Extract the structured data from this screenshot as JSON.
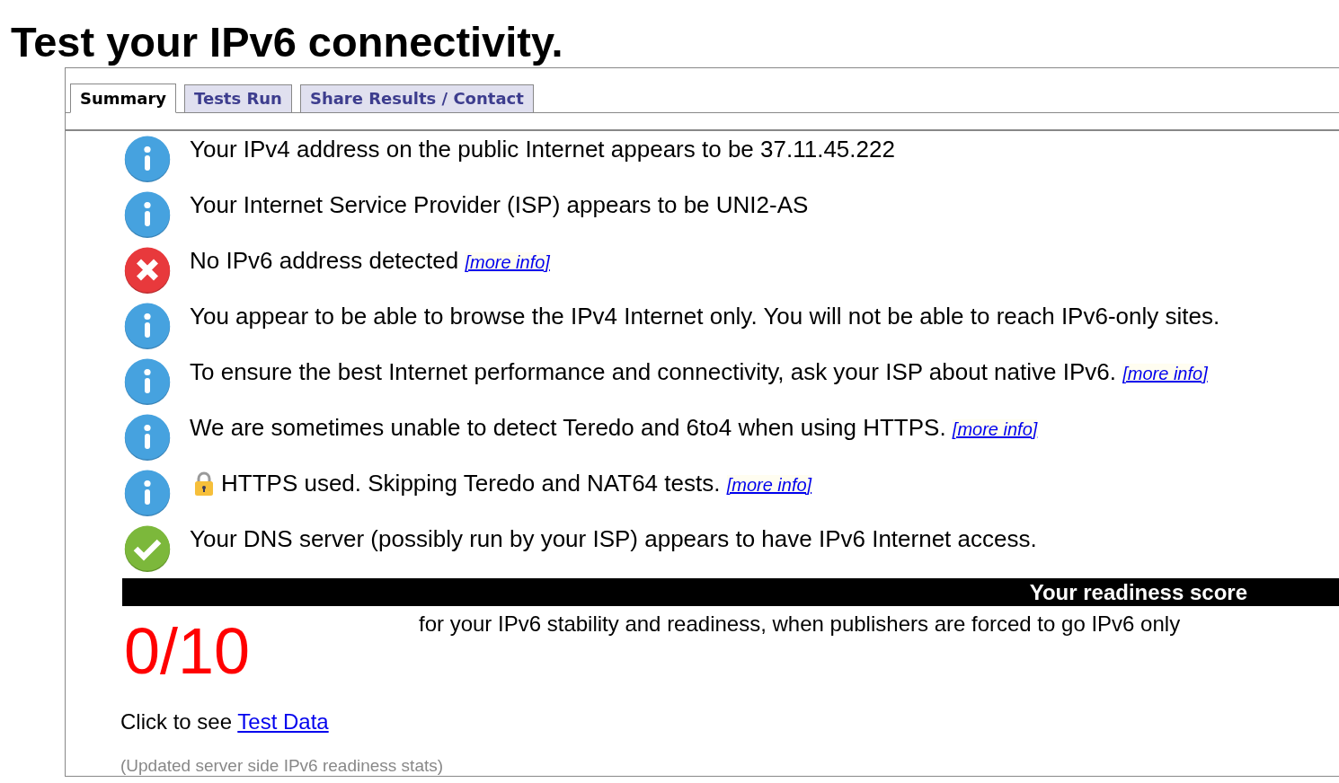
{
  "page": {
    "title": "Test your IPv6 connectivity."
  },
  "tabs": [
    {
      "label": "Summary",
      "selected": true
    },
    {
      "label": "Tests Run",
      "selected": false
    },
    {
      "label": "Share Results / Contact",
      "selected": false
    }
  ],
  "results": [
    {
      "kind": "info",
      "lock": false,
      "text": "Your IPv4 address on the public Internet appears to be 37.11.45.222"
    },
    {
      "kind": "info",
      "lock": false,
      "text": "Your Internet Service Provider (ISP) appears to be UNI2-AS"
    },
    {
      "kind": "error",
      "lock": false,
      "text": "No IPv6 address detected",
      "link": "[more info]"
    },
    {
      "kind": "info",
      "lock": false,
      "text": "You appear to be able to browse the IPv4 Internet only. You will not be able to reach IPv6-only sites."
    },
    {
      "kind": "info",
      "lock": false,
      "text": "To ensure the best Internet performance and connectivity, ask your ISP about native IPv6.",
      "link": "[more info]"
    },
    {
      "kind": "info",
      "lock": false,
      "text": "We are sometimes unable to detect Teredo and 6to4 when using HTTPS.",
      "link": "[more info]"
    },
    {
      "kind": "info",
      "lock": true,
      "text": "HTTPS used. Skipping Teredo and NAT64 tests.",
      "link": "[more info]"
    },
    {
      "kind": "ok",
      "lock": false,
      "text": "Your DNS server (possibly run by your ISP) appears to have IPv6 Internet access."
    }
  ],
  "readiness": {
    "heading": "Your readiness score",
    "score": "0/10",
    "description": "for your IPv6 stability and readiness, when publishers are forced to go IPv6 only"
  },
  "footer": {
    "prompt": "Click to see",
    "link": "Test Data",
    "note": "(Updated server side IPv6 readiness stats)"
  }
}
